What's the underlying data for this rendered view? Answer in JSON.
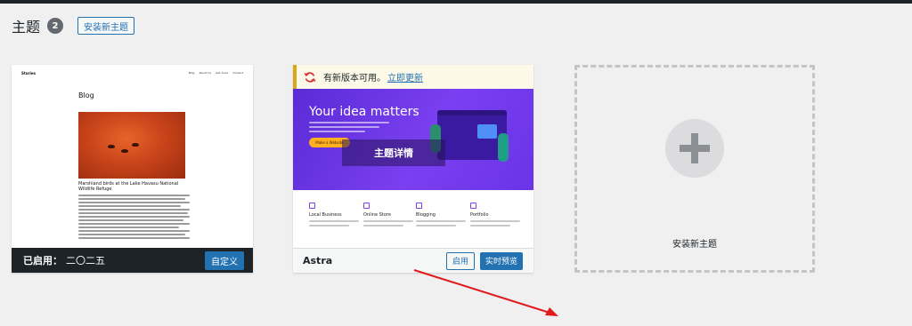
{
  "header": {
    "title": "主题",
    "count": "2",
    "add_new_label": "安装新主题"
  },
  "active_theme": {
    "screenshot": {
      "site_name": "Stories",
      "nav": [
        "Blog",
        "About Us",
        "Get Yours",
        "Contact"
      ],
      "heading": "Blog",
      "caption": "Marshland birds at the Lake Havasu National Wildlife Refuge"
    },
    "active_label": "已启用：",
    "name": "二〇二五",
    "customize_label": "自定义"
  },
  "astra_theme": {
    "update_notice_text": "有新版本可用。",
    "update_link": "立即更新",
    "screenshot": {
      "hero_title": "Your idea matters",
      "hero_button": "Make a Website",
      "features": [
        "Local Business",
        "Online Store",
        "Blogging",
        "Portfolio"
      ]
    },
    "details_overlay": "主题详情",
    "name": "Astra",
    "activate_label": "启用",
    "preview_label": "实时预览"
  },
  "add_new_card": {
    "label": "安装新主题"
  },
  "colors": {
    "accent": "#2271b1",
    "annotation_arrow": "#e01b1b"
  }
}
